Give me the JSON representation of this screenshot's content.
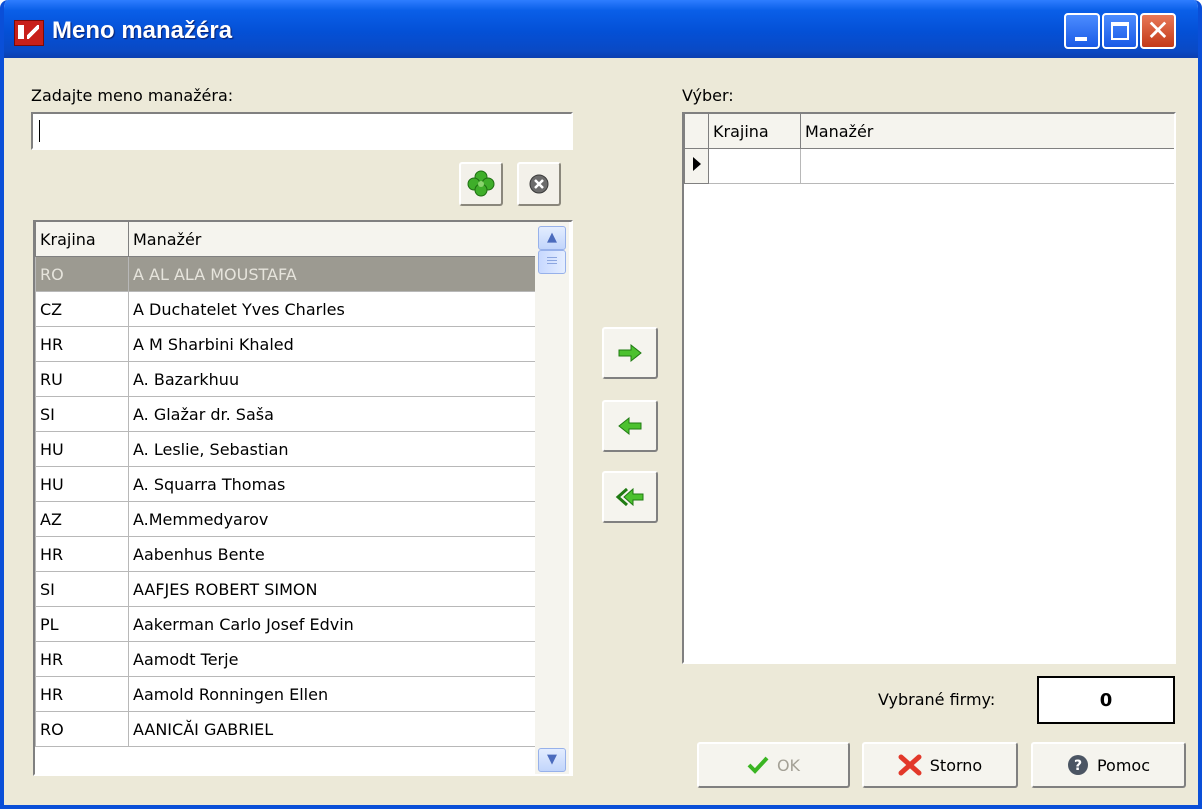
{
  "window": {
    "title": "Meno manažéra"
  },
  "search": {
    "label": "Zadajte meno manažéra:",
    "value": ""
  },
  "left_grid": {
    "headers": [
      "Krajina",
      "Manažér"
    ],
    "rows": [
      {
        "country": "RO",
        "manager": "A AL ALA MOUSTAFA"
      },
      {
        "country": "CZ",
        "manager": "A Duchatelet Yves Charles"
      },
      {
        "country": "HR",
        "manager": "A M Sharbini Khaled"
      },
      {
        "country": "RU",
        "manager": "A. Bazarkhuu"
      },
      {
        "country": "SI",
        "manager": "A. Glažar dr. Saša"
      },
      {
        "country": "HU",
        "manager": "A. Leslie, Sebastian"
      },
      {
        "country": "HU",
        "manager": "A. Squarra Thomas"
      },
      {
        "country": "AZ",
        "manager": "A.Memmedyarov"
      },
      {
        "country": "HR",
        "manager": "Aabenhus Bente"
      },
      {
        "country": "SI",
        "manager": "AAFJES ROBERT SIMON"
      },
      {
        "country": "PL",
        "manager": "Aakerman Carlo Josef Edvin"
      },
      {
        "country": "HR",
        "manager": "Aamodt Terje"
      },
      {
        "country": "HR",
        "manager": "Aamold Ronningen Ellen"
      },
      {
        "country": "RO",
        "manager": "AANICĂI GABRIEL"
      }
    ]
  },
  "right": {
    "label": "Výber:",
    "headers": [
      "Krajina",
      "Manažér"
    ]
  },
  "summary": {
    "label": "Vybrané firmy:",
    "value": "0"
  },
  "buttons": {
    "ok": "OK",
    "cancel": "Storno",
    "help": "Pomoc"
  },
  "icons": {
    "find": "clover-icon",
    "clear": "clear-circle-icon",
    "add": "arrow-right-icon",
    "remove": "arrow-left-icon",
    "remove_all": "double-arrow-left-icon"
  },
  "colors": {
    "titlebar": "#0a4fd8",
    "accent_green": "#2f9e1c",
    "selected_row": "#9c9a91"
  }
}
